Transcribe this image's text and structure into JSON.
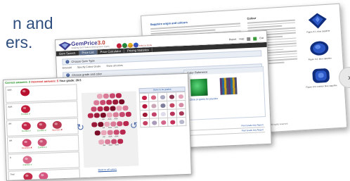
{
  "headline": {
    "line1": "n and",
    "line2": "ers."
  },
  "nav_next": "›",
  "document": {
    "heading_left": "Sapphire origin and colours",
    "heading_right": "Colour",
    "gem_captions": [
      "Figure 3.1: blue sapphire",
      "Figure 3.2: blue sapphire",
      "Figure 3.3: cushion blue sapphire"
    ],
    "footer": "© GemPrice 3.0 – All rights reserved",
    "colors": {
      "blue_dark": "#0f2d7a",
      "blue_mid": "#2a56c6",
      "blue_light": "#5d8ae8"
    }
  },
  "gemprice_window": {
    "logo": {
      "name": "Gem",
      "sup": "Price",
      "version": "3.0",
      "subtitle": "Grading Gem Values Among Gem Types",
      "tagline": "Click an icon above to select a stone"
    },
    "nav": [
      "Gem Search",
      "Price List",
      "Price Calculator",
      "Pricing Statistics"
    ],
    "selected_tab": "Gem Search",
    "tools": [
      "Report",
      "Help",
      "Exit"
    ],
    "sections": [
      {
        "num": "1",
        "label": "Choose Gem Type"
      },
      {
        "num": "2",
        "label": "Choose grade and color"
      }
    ],
    "options": [
      "Emerald",
      "Specify Colour Grade",
      "Show all colors"
    ],
    "color_reference": {
      "title": "Color Reference",
      "note": "Click on gems for practice",
      "swatches": [
        "#1f8f3a",
        "#4a4a6a"
      ]
    },
    "table_rows": [
      "Print Grade Key  Report",
      "Print Grade Key  Report"
    ]
  },
  "quiz_window": {
    "correct_label": "Correct answers:",
    "correct_count": "2",
    "incorrect_label": "Incorrect answers:",
    "incorrect_count": "5",
    "grade_label": "Your grade:",
    "grade_value": "28.5",
    "rows": [
      {
        "label": "AAA",
        "cells": [
          {
            "color": "#b7102e",
            "status": ""
          }
        ]
      },
      {
        "label": "AAA",
        "cells": [
          {
            "color": "#c21c3a",
            "status": "Correct ✔"
          }
        ]
      },
      {
        "label": "AA",
        "cells": [
          {
            "color": "#c4284a",
            "status": "Correct ✔"
          },
          {
            "color": "#c13653",
            "status": "Correct ✔"
          },
          {
            "color": "#b83a52",
            "status": "Incorrect ✘"
          }
        ]
      },
      {
        "label": "AA",
        "cells": [
          {
            "color": "#d0436a",
            "status": "Incorrect ✘"
          },
          {
            "color": "#cc5477",
            "status": "Correct ✔"
          }
        ]
      },
      {
        "label": "A",
        "cells": [
          {
            "color": "#d96a8a",
            "status": "Correct ✔"
          }
        ]
      },
      {
        "label": "Trial",
        "cells": [
          {
            "color": "#c22a4a",
            "status": ""
          },
          {
            "color": "#d65580",
            "status": "Correct ✔"
          }
        ]
      }
    ],
    "hex_labels": [
      "AA",
      "AAA",
      "AAA"
    ],
    "back_link": "Back to all colors",
    "grid_title": "Stone to be graded",
    "grid_colors": [
      "#c7234a",
      "#d7607e",
      "#a9a9c2",
      "#8b3550",
      "#e3a3b8",
      "#b5183c",
      "#caa5b5",
      "#7d7d9c",
      "#c24360",
      "#d58aa2",
      "#9f1a36",
      "#c2436a",
      "#dcdcec",
      "#b7355a",
      "#a83858",
      "#c64062",
      "#a89ab8",
      "#d36588",
      "#c3305a",
      "#b8b8cc"
    ]
  }
}
